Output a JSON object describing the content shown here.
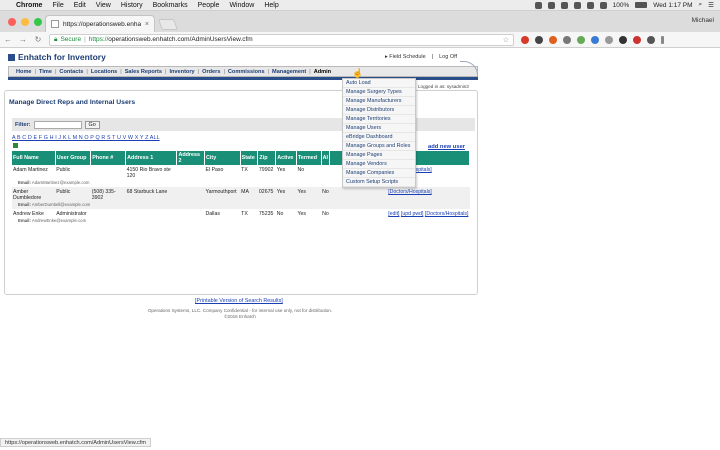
{
  "os_menubar": {
    "apple": "",
    "items": [
      "Chrome",
      "File",
      "Edit",
      "View",
      "History",
      "Bookmarks",
      "People",
      "Window",
      "Help"
    ],
    "battery": "100%",
    "clock": "Wed 1:17 PM"
  },
  "browser": {
    "tab_title": "https://operationsweb.enhatch",
    "tab_close": "×",
    "profile": "Michael",
    "secure_label": "Secure",
    "url_scheme": "https://",
    "url_rest": "operationsweb.enhatch.com/AdminUsersView.cfm",
    "status_url": "https://operationsweb.enhatch.com/AdminUsersView.cfm"
  },
  "header": {
    "logo": "Enhatch for Inventory",
    "field_schedule": "Field Schedule",
    "log_off": "Log Off",
    "logged_in": "Logged in as: sysadmin3"
  },
  "nav": [
    "Home",
    "Time",
    "Contacts",
    "Locations",
    "Sales Reports",
    "Inventory",
    "Orders",
    "Commissions",
    "Management",
    "Admin"
  ],
  "admin_menu": [
    "Auto Load",
    "Manage Surgery Types",
    "Manage Manufacturers",
    "Manage Distributors",
    "Manage Territories",
    "Manage Users",
    "eBridge Dashboard",
    "Manage Groups and Roles",
    "Manage Pages",
    "Manage Vendors",
    "Manage Companies",
    "Custom Setup Scripts"
  ],
  "main": {
    "title": "Manage Direct Reps and Internal Users",
    "filter_label": "Filter:",
    "go": "Go",
    "alphabet": "A B C D E F G H I J K L M N O P Q R S T U V W X Y Z ALL",
    "add_new_user": "add new user",
    "columns": [
      "Full Name",
      "User Group",
      "Phone #",
      "Address 1",
      "Address 2",
      "City",
      "State",
      "Zip",
      "Active",
      "Termed",
      "Al",
      "",
      "tion"
    ],
    "rows": [
      {
        "name": "Adam Martinez",
        "group": "Public",
        "phone": "",
        "addr1": "4150 Rio Bravo ste 120",
        "addr2": "",
        "city": "El Paso",
        "state": "TX",
        "zip": "79902",
        "active": "Yes",
        "termed": "No",
        "al": "",
        "edit": "",
        "upd": "",
        "doctors": "[Doctors/Hospitals]",
        "email_label": "Email:",
        "email": "AdamMartinez@example.com"
      },
      {
        "name": "Amber Dumbledore",
        "group": "Public",
        "phone": "(508) 335-3902",
        "addr1": "68 Starbuck Lane",
        "addr2": "",
        "city": "Yarmouthport",
        "state": "MA",
        "zip": "02675",
        "active": "Yes",
        "termed": "Yes",
        "al": "No",
        "edit": "",
        "upd": "",
        "doctors": "[Doctors/Hospitals]",
        "email_label": "Email:",
        "email": "AmberDumbell@example.com"
      },
      {
        "name": "Andrew Enke",
        "group": "Administrator",
        "phone": "",
        "addr1": "",
        "addr2": "",
        "city": "Dallas",
        "state": "TX",
        "zip": "75235",
        "active": "No",
        "termed": "Yes",
        "al": "No",
        "edit": "[edit]",
        "upd": "[upd pwd]",
        "doctors": "[Doctors/Hospitals]",
        "email_label": "Email:",
        "email": "AndrewEnke@example.com"
      }
    ],
    "print_link": "[Printable Version of Search Results]",
    "footer_line1": "Operations Systems, LLC. Company Confidential - for internal use only, not for distribution.",
    "footer_line2": "©2016 Enhatch"
  }
}
